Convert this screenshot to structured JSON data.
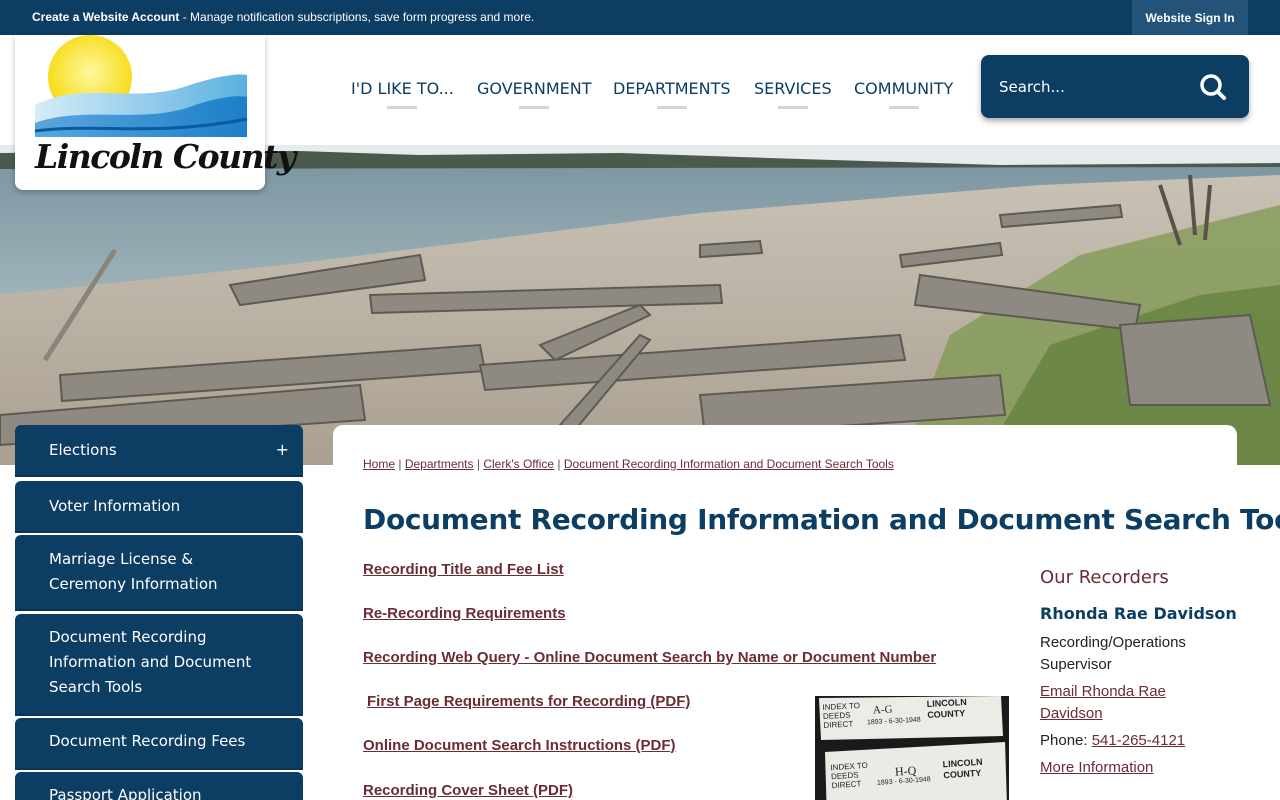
{
  "topbar": {
    "message_bold": "Create a Website Account",
    "message_rest": " - Manage notification subscriptions, save form progress and more.",
    "signin_label": "Website Sign In"
  },
  "logo": {
    "text": "Lincoln County"
  },
  "nav": {
    "items": [
      "I'D LIKE TO...",
      "GOVERNMENT",
      "DEPARTMENTS",
      "SERVICES",
      "COMMUNITY"
    ]
  },
  "search": {
    "placeholder": "Search..."
  },
  "sidebar": {
    "items": [
      {
        "label": "Elections",
        "expand": "+"
      },
      {
        "label": "Voter Information"
      },
      {
        "label": "Marriage License & Ceremony Information"
      },
      {
        "label": "Document Recording Information and Document Search Tools"
      },
      {
        "label": "Document Recording Fees"
      },
      {
        "label": "Passport Application"
      }
    ]
  },
  "breadcrumb": {
    "items": [
      "Home",
      "Departments",
      "Clerk's Office",
      "Document Recording Information and Document Search Tools"
    ],
    "separator": " | "
  },
  "main": {
    "title": "Document Recording Information and Document Search Tools",
    "links": [
      "Recording Title and Fee List",
      "Re-Recording Requirements",
      "Recording Web Query - Online Document Search by Name or Document Number",
      "First Page Requirements for Recording (PDF)",
      "Online Document Search Instructions (PDF)",
      "Recording Cover Sheet (PDF)"
    ],
    "image": {
      "book1_line1": "INDEX TO",
      "book1_line2": "DEEDS",
      "book1_line3": "DIRECT",
      "book1_letters": "A-G",
      "book1_dates": "1893 - 6-30-1948",
      "book1_county1": "LINCOLN",
      "book1_county2": "COUNTY",
      "book2_line1": "INDEX TO",
      "book2_line2": "DEEDS",
      "book2_line3": "DIRECT",
      "book2_letters": "H-Q",
      "book2_dates": "1893 - 6-30-1948",
      "book2_county1": "LINCOLN",
      "book2_county2": "COUNTY"
    }
  },
  "recorders": {
    "heading": "Our Recorders",
    "name": "Rhonda Rae Davidson",
    "role": "Recording/Operations Supervisor",
    "email_label": "Email Rhonda Rae Davidson",
    "phone_label": "Phone: ",
    "phone": "541-265-4121",
    "more": "More Information"
  },
  "colors": {
    "navy": "#0c3d63",
    "link_maroon": "#6b2c33"
  }
}
